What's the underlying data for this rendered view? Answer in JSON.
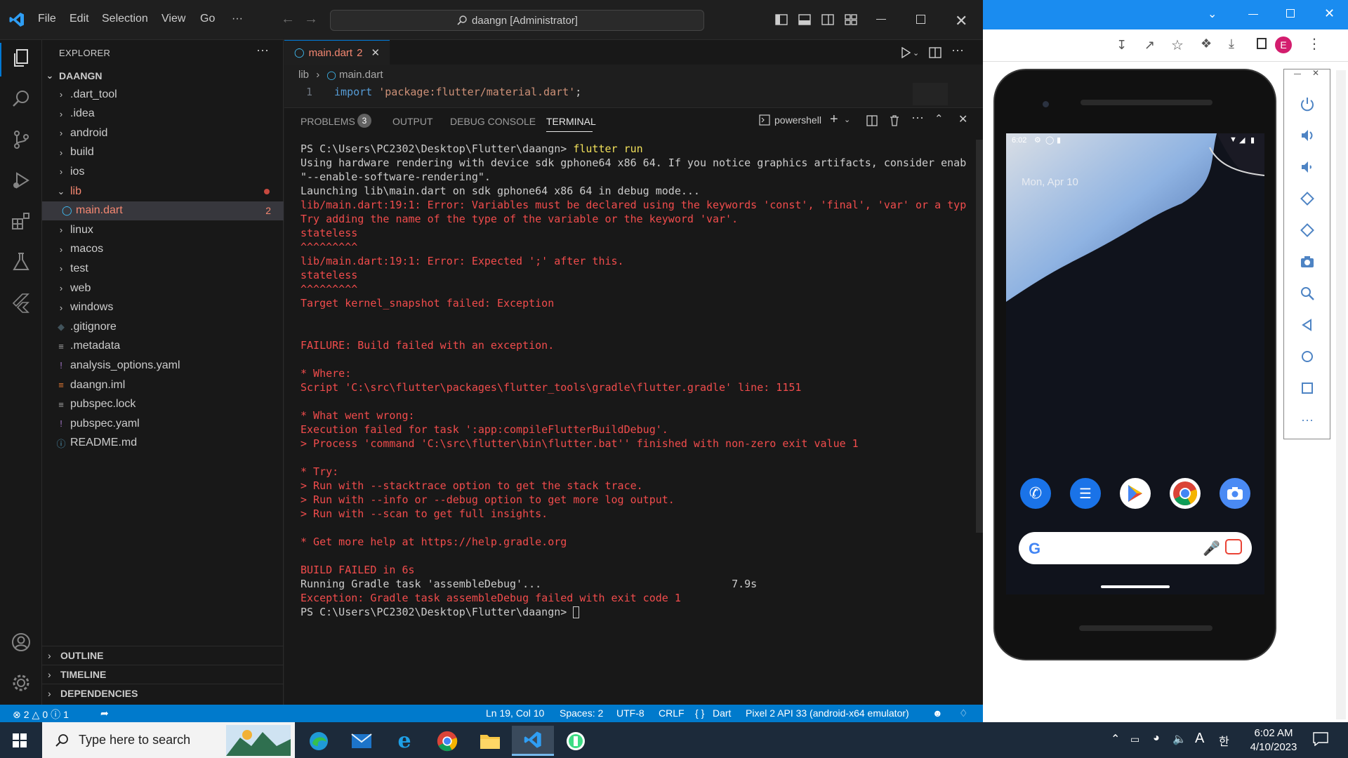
{
  "titlebar": {
    "menus": [
      "File",
      "Edit",
      "Selection",
      "View",
      "Go",
      "···"
    ],
    "command_center": "daangn [Administrator]"
  },
  "explorer": {
    "header": "EXPLORER",
    "root": "DAANGN",
    "items": [
      {
        "label": ".dart_tool",
        "kind": "folder"
      },
      {
        "label": ".idea",
        "kind": "folder"
      },
      {
        "label": "android",
        "kind": "folder"
      },
      {
        "label": "build",
        "kind": "folder"
      },
      {
        "label": "ios",
        "kind": "folder"
      },
      {
        "label": "lib",
        "kind": "folder-open"
      },
      {
        "label": "main.dart",
        "kind": "file",
        "badge": "2"
      },
      {
        "label": "linux",
        "kind": "folder"
      },
      {
        "label": "macos",
        "kind": "folder"
      },
      {
        "label": "test",
        "kind": "folder"
      },
      {
        "label": "web",
        "kind": "folder"
      },
      {
        "label": "windows",
        "kind": "folder"
      },
      {
        "label": ".gitignore",
        "kind": "file"
      },
      {
        "label": ".metadata",
        "kind": "file"
      },
      {
        "label": "analysis_options.yaml",
        "kind": "file"
      },
      {
        "label": "daangn.iml",
        "kind": "file"
      },
      {
        "label": "pubspec.lock",
        "kind": "file"
      },
      {
        "label": "pubspec.yaml",
        "kind": "file"
      },
      {
        "label": "README.md",
        "kind": "file"
      }
    ],
    "sections": [
      "OUTLINE",
      "TIMELINE",
      "DEPENDENCIES"
    ]
  },
  "editor": {
    "tab_label": "main.dart",
    "tab_badge": "2",
    "breadcrumb_folder": "lib",
    "breadcrumb_file": "main.dart",
    "line_number": "1",
    "code_keyword": "import",
    "code_string": "'package:flutter/material.dart'",
    "code_end": ";"
  },
  "panel": {
    "tabs": [
      "PROBLEMS",
      "OUTPUT",
      "DEBUG CONSOLE",
      "TERMINAL"
    ],
    "problems_count": "3",
    "shell": "powershell",
    "terminal_lines": [
      {
        "t": "PS C:\\Users\\PC2302\\Desktop\\Flutter\\daangn> flutter run",
        "c": "norm"
      },
      {
        "t": "Using hardware rendering with device sdk gphone64 x86 64. If you notice graphics artifacts, consider enab",
        "c": "norm"
      },
      {
        "t": "\"--enable-software-rendering\".",
        "c": "norm"
      },
      {
        "t": "Launching lib\\main.dart on sdk gphone64 x86 64 in debug mode...",
        "c": "norm"
      },
      {
        "t": "lib/main.dart:19:1: Error: Variables must be declared using the keywords 'const', 'final', 'var' or a typ",
        "c": "err"
      },
      {
        "t": "Try adding the name of the type of the variable or the keyword 'var'.",
        "c": "err"
      },
      {
        "t": "stateless",
        "c": "err"
      },
      {
        "t": "^^^^^^^^^",
        "c": "err"
      },
      {
        "t": "lib/main.dart:19:1: Error: Expected ';' after this.",
        "c": "err"
      },
      {
        "t": "stateless",
        "c": "err"
      },
      {
        "t": "^^^^^^^^^",
        "c": "err"
      },
      {
        "t": "Target kernel_snapshot failed: Exception",
        "c": "err"
      },
      {
        "t": "",
        "c": "norm"
      },
      {
        "t": "",
        "c": "norm"
      },
      {
        "t": "FAILURE: Build failed with an exception.",
        "c": "err"
      },
      {
        "t": "",
        "c": "norm"
      },
      {
        "t": "* Where:",
        "c": "err"
      },
      {
        "t": "Script 'C:\\src\\flutter\\packages\\flutter_tools\\gradle\\flutter.gradle' line: 1151",
        "c": "err"
      },
      {
        "t": "",
        "c": "norm"
      },
      {
        "t": "* What went wrong:",
        "c": "err"
      },
      {
        "t": "Execution failed for task ':app:compileFlutterBuildDebug'.",
        "c": "err"
      },
      {
        "t": "> Process 'command 'C:\\src\\flutter\\bin\\flutter.bat'' finished with non-zero exit value 1",
        "c": "err"
      },
      {
        "t": "",
        "c": "norm"
      },
      {
        "t": "* Try:",
        "c": "err"
      },
      {
        "t": "> Run with --stacktrace option to get the stack trace.",
        "c": "err"
      },
      {
        "t": "> Run with --info or --debug option to get more log output.",
        "c": "err"
      },
      {
        "t": "> Run with --scan to get full insights.",
        "c": "err"
      },
      {
        "t": "",
        "c": "norm"
      },
      {
        "t": "* Get more help at https://help.gradle.org",
        "c": "err"
      },
      {
        "t": "",
        "c": "norm"
      },
      {
        "t": "BUILD FAILED in 6s",
        "c": "err"
      },
      {
        "t": "Running Gradle task 'assembleDebug'...                              7.9s",
        "c": "norm"
      },
      {
        "t": "Exception: Gradle task assembleDebug failed with exit code 1",
        "c": "err"
      },
      {
        "t": "PS C:\\Users\\PC2302\\Desktop\\Flutter\\daangn> ",
        "c": "norm"
      }
    ]
  },
  "statusbar": {
    "errors": "2",
    "warnings": "0",
    "infos": "1",
    "position": "Ln 19, Col 10",
    "spaces": "Spaces: 2",
    "encoding": "UTF-8",
    "eol": "CRLF",
    "language": "Dart",
    "device": "Pixel 2 API 33 (android-x64 emulator)"
  },
  "browser": {
    "profile_letter": "E"
  },
  "phone": {
    "status_time": "6:02",
    "date_text": "Mon, Apr 10"
  },
  "taskbar": {
    "search_placeholder": "Type here to search",
    "time": "6:02 AM",
    "date": "4/10/2023",
    "ime": "A",
    "ime2": "한"
  },
  "colors": {
    "accent": "#007acc",
    "error": "#f14c4c",
    "taskbar": "#1c2a3a"
  }
}
